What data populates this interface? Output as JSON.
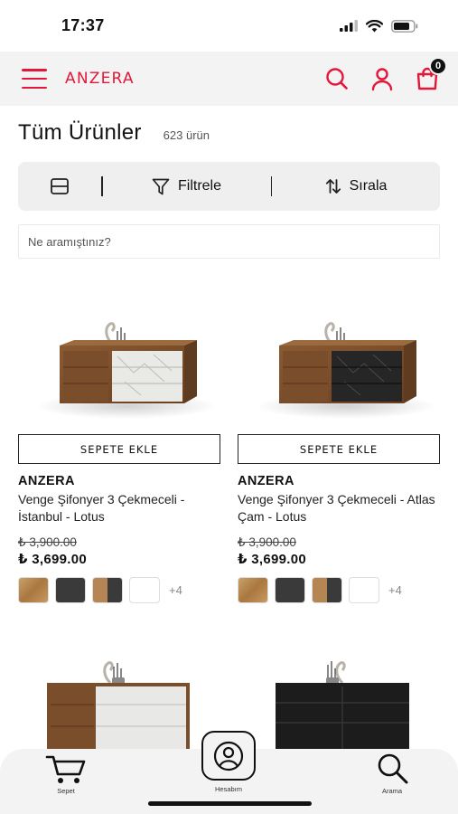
{
  "status_bar": {
    "time": "17:37"
  },
  "header": {
    "logo": "ANZERA",
    "cart_count": "0"
  },
  "listing": {
    "title": "Tüm Ürünler",
    "count": "623 ürün"
  },
  "toolbar": {
    "filter_label": "Filtrele",
    "sort_label": "Sırala"
  },
  "search": {
    "placeholder": "Ne aramıştınız?"
  },
  "products": [
    {
      "add_label": "SEPETE EKLE",
      "brand": "ANZERA",
      "name": "Venge Şifonyer 3 Çekmeceli - İstanbul - Lotus",
      "old_price": "₺ 3,900.00",
      "price": "₺ 3,699.00",
      "swatches": [
        "#b8894f",
        "#3a3a3a",
        "#a8784a",
        "#ffffff"
      ],
      "more": "+4"
    },
    {
      "add_label": "SEPETE EKLE",
      "brand": "ANZERA",
      "name": "Venge Şifonyer 3 Çekmeceli - Atlas Çam - Lotus",
      "old_price": "₺ 3,900.00",
      "price": "₺ 3,699.00",
      "swatches": [
        "#b8894f",
        "#3a3a3a",
        "#a8784a",
        "#ffffff"
      ],
      "more": "+4"
    }
  ],
  "bottom_nav": {
    "cart_label": "Sepet",
    "account_label": "Hesabım",
    "search_label": "Arama"
  },
  "colors": {
    "accent": "#e4173b",
    "header_bg": "#f3f3f3"
  }
}
